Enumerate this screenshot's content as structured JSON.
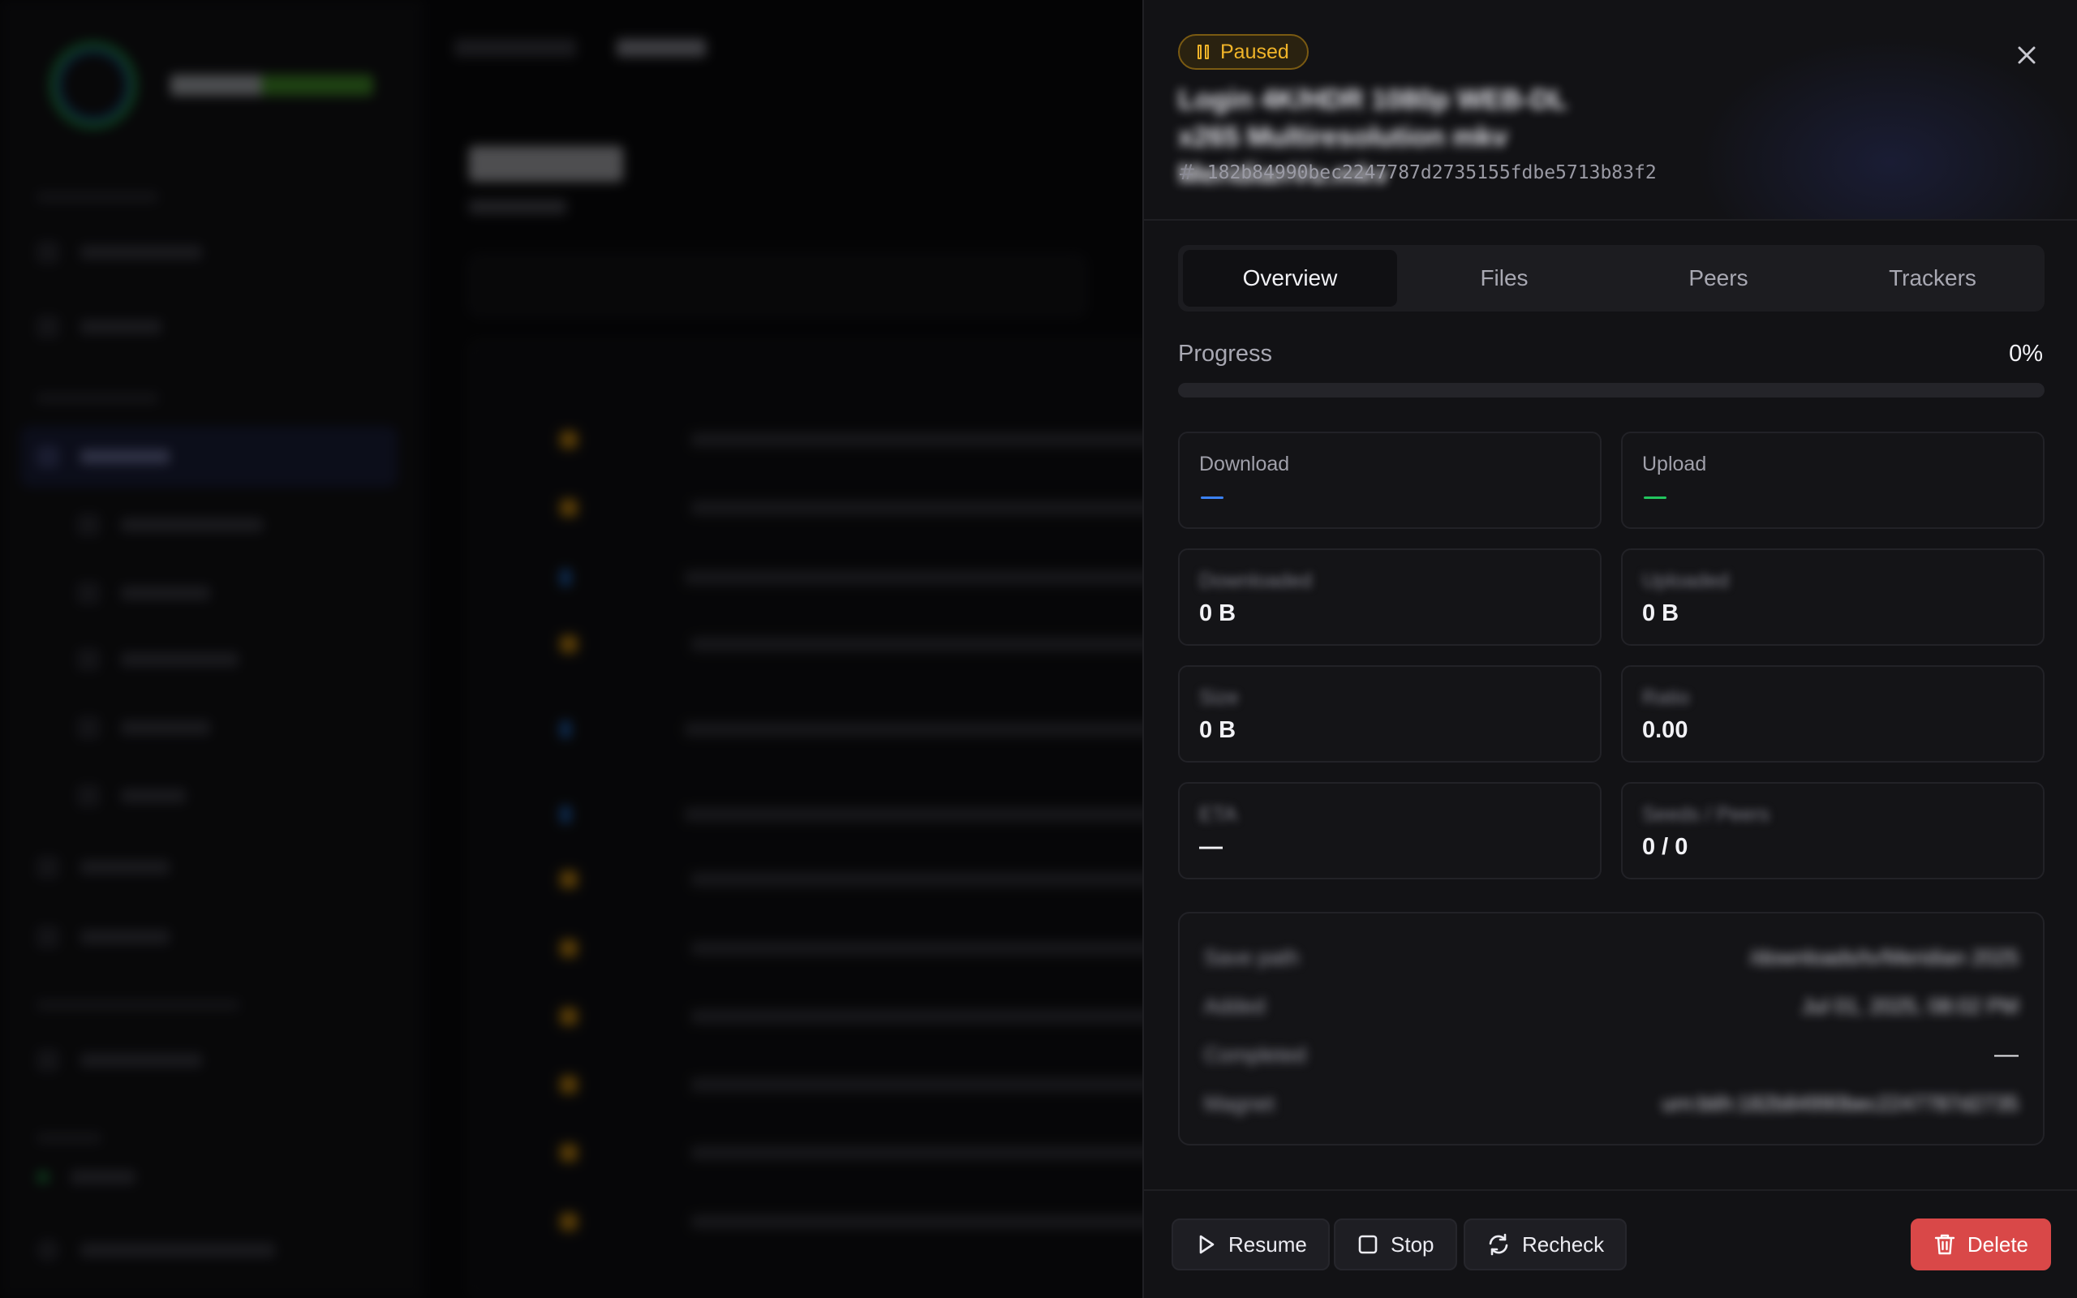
{
  "drawer": {
    "status": "Paused",
    "torrent_name": "Login 4K/HDR 1080p WEB-DL x265 Multiresolution mkv MeridianVu.mkv",
    "info_hash": "182b84990bec2247787d2735155fdbe5713b83f2",
    "tabs": [
      {
        "label": "Overview",
        "active": true
      },
      {
        "label": "Files",
        "active": false
      },
      {
        "label": "Peers",
        "active": false
      },
      {
        "label": "Trackers",
        "active": false
      }
    ],
    "progress": {
      "label": "Progress",
      "value_text": "0%",
      "fraction": 0
    },
    "stats": {
      "download": {
        "label": "Download",
        "accent": "#3b82f6"
      },
      "upload": {
        "label": "Upload",
        "accent": "#22c55e"
      },
      "downloaded": {
        "label": "Downloaded",
        "value": "0 B"
      },
      "uploaded": {
        "label": "Uploaded",
        "value": "0 B"
      },
      "size": {
        "label": "Size",
        "value": "0 B"
      },
      "ratio": {
        "label": "Ratio",
        "value": "0.00"
      },
      "eta": {
        "label": "ETA",
        "value": "—"
      },
      "seeds_peers": {
        "label": "Seeds / Peers",
        "value": "0 / 0"
      }
    },
    "info": {
      "rows": [
        {
          "key": "Save path",
          "value": "/downloads/tv/Meridian 2025"
        },
        {
          "key": "Added",
          "value": "Jul 01, 2025, 08:02 PM"
        },
        {
          "key": "Completed",
          "value": "—"
        },
        {
          "key": "Magnet",
          "value": "urn:btih:182b84990bec2247787d2735"
        }
      ]
    },
    "actions": {
      "resume": "Resume",
      "stop": "Stop",
      "recheck": "Recheck",
      "delete": "Delete"
    }
  },
  "colors": {
    "paused": "#f0b429",
    "danger": "#d94848",
    "download_accent": "#3b82f6",
    "upload_accent": "#22c55e"
  }
}
